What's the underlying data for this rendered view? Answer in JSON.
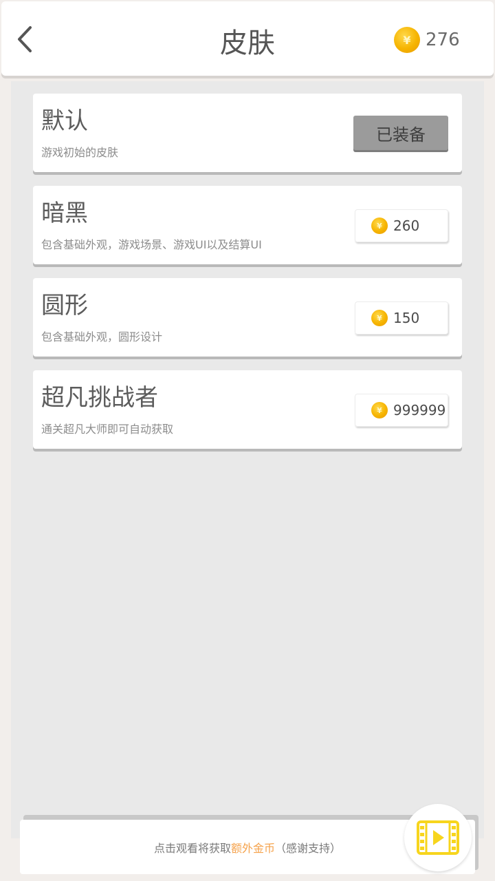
{
  "header": {
    "title": "皮肤",
    "coins": "276",
    "back_icon": "chevron-left-icon",
    "coin_icon": "coin-icon",
    "coin_symbol": "¥"
  },
  "skins": [
    {
      "name": "默认",
      "description": "游戏初始的皮肤",
      "status": "已装备"
    },
    {
      "name": "暗黑",
      "description": "包含基础外观，游戏场景、游戏UI以及结算UI",
      "price": "260"
    },
    {
      "name": "圆形",
      "description": "包含基础外观，圆形设计",
      "price": "150"
    },
    {
      "name": "超凡挑战者",
      "description": "通关超凡大师即可自动获取",
      "price": "999999"
    }
  ],
  "footer": {
    "text_before": "点击观看将获取",
    "text_highlight": "额外金币",
    "text_after": "（感谢支持）",
    "video_icon": "film-play-icon"
  },
  "colors": {
    "coin": "#f6b400",
    "highlight": "#f5a24b",
    "video_icon": "#f7d51d",
    "equipped_button": "#9b9b9b"
  }
}
